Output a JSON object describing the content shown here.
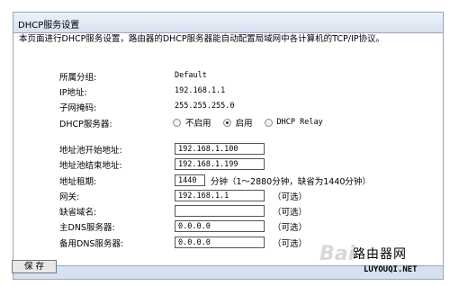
{
  "title": "DHCP服务设置",
  "description": "本页面进行DHCP服务设置，路由器的DHCP服务器能自动配置局域网中各计算机的TCP/IP协议。",
  "fields": {
    "group_label": "所属分组:",
    "group_value": "Default",
    "ip_label": "IP地址:",
    "ip_value": "192.168.1.1",
    "mask_label": "子网掩码:",
    "mask_value": "255.255.255.0",
    "dhcp_label": "DHCP服务器:"
  },
  "dhcp_options": [
    {
      "label": "不启用",
      "checked": false
    },
    {
      "label": "启用",
      "checked": true
    },
    {
      "label": "DHCP Relay",
      "checked": false
    }
  ],
  "pool": {
    "start_label": "地址池开始地址:",
    "start_value": "192.168.1.100",
    "end_label": "地址池结束地址:",
    "end_value": "192.168.1.199",
    "lease_label": "地址租期:",
    "lease_value": "1440",
    "lease_hint": "分钟（1～2880分钟，缺省为1440分钟）",
    "gateway_label": "网关:",
    "gateway_value": "192.168.1.1",
    "domain_label": "缺省域名:",
    "domain_value": "",
    "dns1_label": "主DNS服务器:",
    "dns1_value": "0.0.0.0",
    "dns2_label": "备用DNS服务器:",
    "dns2_value": "0.0.0.0",
    "optional": "（可选）"
  },
  "save_label": "保 存",
  "watermark": {
    "baidu": "Bai",
    "line1": "路由器网",
    "line2": "LUYOUQI.NET"
  }
}
